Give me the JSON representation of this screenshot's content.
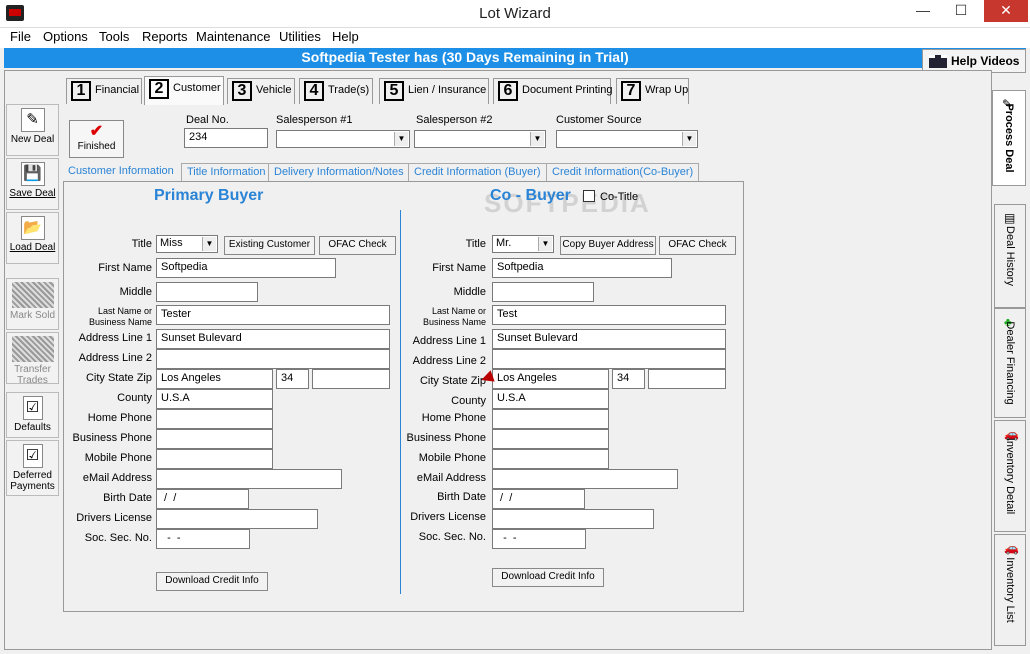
{
  "window": {
    "title": "Lot Wizard",
    "minimize": "—",
    "maximize": "☐",
    "close": "✕"
  },
  "menu": [
    "File",
    "Options",
    "Tools",
    "Reports",
    "Maintenance",
    "Utilities",
    "Help"
  ],
  "banner": {
    "trial_text": "Softpedia Tester has   (30 Days Remaining in Trial)",
    "help_videos": "Help Videos"
  },
  "left_toolbar": [
    {
      "label": "New Deal",
      "icon": "new-deal-icon",
      "glyph": "✎",
      "enabled": true
    },
    {
      "label": "Save Deal",
      "icon": "save-icon",
      "glyph": "💾",
      "enabled": true
    },
    {
      "label": "Load Deal",
      "icon": "load-folder-icon",
      "glyph": "📂",
      "enabled": true
    },
    {
      "label": "Mark Sold",
      "icon": "mark-sold-icon",
      "glyph": "",
      "enabled": false
    },
    {
      "label": "Transfer Trades",
      "icon": "transfer-trades-icon",
      "glyph": "",
      "enabled": false
    },
    {
      "label": "Defaults",
      "icon": "defaults-checklist-icon",
      "glyph": "☑",
      "enabled": true
    },
    {
      "label": "Deferred Payments",
      "icon": "deferred-payments-icon",
      "glyph": "☑",
      "enabled": true
    }
  ],
  "main_tabs": [
    {
      "num": "1",
      "label": "Financial"
    },
    {
      "num": "2",
      "label": "Customer",
      "active": true
    },
    {
      "num": "3",
      "label": "Vehicle"
    },
    {
      "num": "4",
      "label": "Trade(s)"
    },
    {
      "num": "5",
      "label": "Lien / Insurance"
    },
    {
      "num": "6",
      "label": "Document Printing"
    },
    {
      "num": "7",
      "label": "Wrap Up"
    }
  ],
  "deal": {
    "finished_label": "Finished",
    "deal_no_label": "Deal No.",
    "deal_no": "234",
    "salesperson1_label": "Salesperson #1",
    "salesperson1": "",
    "salesperson2_label": "Salesperson #2",
    "salesperson2": "",
    "customer_source_label": "Customer Source",
    "customer_source": ""
  },
  "sub_tabs": [
    "Customer Information",
    "Title Information",
    "Delivery Information/Notes",
    "Credit Information (Buyer)",
    "Credit Information(Co-Buyer)"
  ],
  "labels": {
    "title": "Title",
    "first_name": "First Name",
    "middle": "Middle",
    "last_name_1": "Last Name or",
    "last_name_2": "Business Name",
    "address1": "Address Line 1",
    "address2": "Address Line 2",
    "city_state_zip": "City State Zip",
    "county": "County",
    "home_phone": "Home Phone",
    "business_phone": "Business Phone",
    "mobile_phone": "Mobile Phone",
    "email": "eMail Address",
    "birth_date": "Birth Date",
    "drivers_license": "Drivers License",
    "ssn": "Soc. Sec. No.",
    "ofac": "OFAC Check",
    "download_credit": "Download Credit Info"
  },
  "primary_buyer": {
    "heading": "Primary Buyer",
    "title": "Miss",
    "existing_customer": "Existing Customer",
    "first_name": "Softpedia",
    "middle": "",
    "last_name": "Tester",
    "address1": "Sunset Bulevard",
    "address2": "",
    "city": "Los Angeles",
    "state": "34",
    "zip": "",
    "county": "U.S.A",
    "home_phone": "",
    "business_phone": "",
    "mobile_phone": "",
    "email": "",
    "birth_date": " /  /",
    "drivers_license": "",
    "ssn": "  -  -"
  },
  "co_buyer": {
    "heading": "Co - Buyer",
    "co_title_label": "Co-Title",
    "title": "Mr.",
    "copy_address": "Copy Buyer Address",
    "first_name": "Softpedia",
    "middle": "",
    "last_name": "Test",
    "address1": "Sunset Bulevard",
    "address2": "",
    "city": "Los Angeles",
    "state": "34",
    "zip": "",
    "county": "U.S.A",
    "home_phone": "",
    "business_phone": "",
    "mobile_phone": "",
    "email": "",
    "birth_date": " /  /",
    "drivers_license": "",
    "ssn": "  -  -"
  },
  "watermark": "SOFTPEDIA",
  "right_tabs": [
    {
      "label": "Process Deal",
      "icon": "process-deal-icon",
      "glyph": "✎",
      "active": true
    },
    {
      "label": "Deal History",
      "icon": "deal-history-icon",
      "glyph": "▤"
    },
    {
      "label": "Dealer Financing",
      "icon": "dealer-financing-icon",
      "glyph": "♣"
    },
    {
      "label": "Inventory Detail",
      "icon": "inventory-detail-car-icon",
      "glyph": "🚗"
    },
    {
      "label": "Inventory List",
      "icon": "inventory-list-car-icon",
      "glyph": "🚗"
    }
  ]
}
